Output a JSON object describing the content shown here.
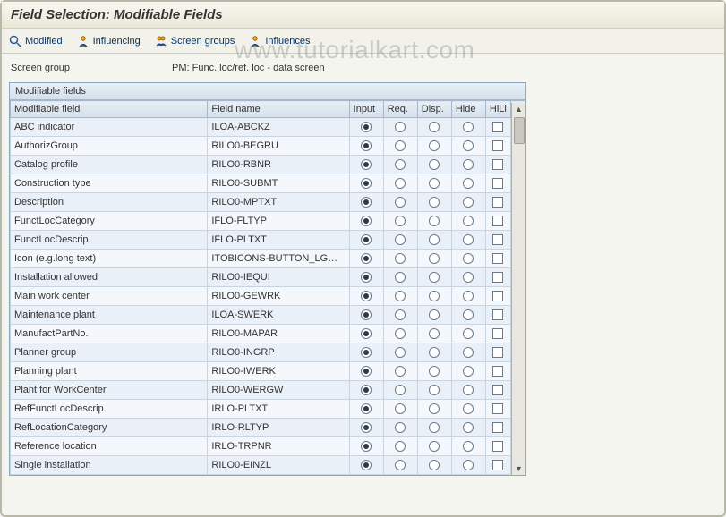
{
  "title": "Field Selection: Modifiable Fields",
  "toolbar": {
    "modified": "Modified",
    "influencing": "Influencing",
    "screen_groups": "Screen groups",
    "influences": "Influences"
  },
  "screen_group": {
    "label": "Screen group",
    "value": "PM: Func. loc/ref. loc - data screen"
  },
  "table": {
    "caption": "Modifiable fields",
    "columns": {
      "modifiable_field": "Modifiable field",
      "field_name": "Field name",
      "input": "Input",
      "req": "Req.",
      "disp": "Disp.",
      "hide": "Hide",
      "hili": "HiLi"
    },
    "rows": [
      {
        "label": "ABC indicator",
        "name": "ILOA-ABCKZ",
        "sel": "input"
      },
      {
        "label": "AuthorizGroup",
        "name": "RILO0-BEGRU",
        "sel": "input"
      },
      {
        "label": "Catalog profile",
        "name": "RILO0-RBNR",
        "sel": "input"
      },
      {
        "label": "Construction type",
        "name": "RILO0-SUBMT",
        "sel": "input"
      },
      {
        "label": "Description",
        "name": "RILO0-MPTXT",
        "sel": "input"
      },
      {
        "label": "FunctLocCategory",
        "name": "IFLO-FLTYP",
        "sel": "input"
      },
      {
        "label": "FunctLocDescrip.",
        "name": "IFLO-PLTXT",
        "sel": "input"
      },
      {
        "label": "Icon (e.g.long text)",
        "name": "ITOBICONS-BUTTON_LG…",
        "sel": "input"
      },
      {
        "label": "Installation allowed",
        "name": "RILO0-IEQUI",
        "sel": "input"
      },
      {
        "label": "Main work center",
        "name": "RILO0-GEWRK",
        "sel": "input"
      },
      {
        "label": "Maintenance plant",
        "name": "ILOA-SWERK",
        "sel": "input"
      },
      {
        "label": "ManufactPartNo.",
        "name": "RILO0-MAPAR",
        "sel": "input"
      },
      {
        "label": "Planner group",
        "name": "RILO0-INGRP",
        "sel": "input"
      },
      {
        "label": "Planning plant",
        "name": "RILO0-IWERK",
        "sel": "input"
      },
      {
        "label": "Plant for WorkCenter",
        "name": "RILO0-WERGW",
        "sel": "input"
      },
      {
        "label": "RefFunctLocDescrip.",
        "name": "IRLO-PLTXT",
        "sel": "input"
      },
      {
        "label": "RefLocationCategory",
        "name": "IRLO-RLTYP",
        "sel": "input"
      },
      {
        "label": "Reference location",
        "name": "IRLO-TRPNR",
        "sel": "input"
      },
      {
        "label": "Single installation",
        "name": "RILO0-EINZL",
        "sel": "input"
      }
    ]
  },
  "watermark": "www.tutorialkart.com"
}
